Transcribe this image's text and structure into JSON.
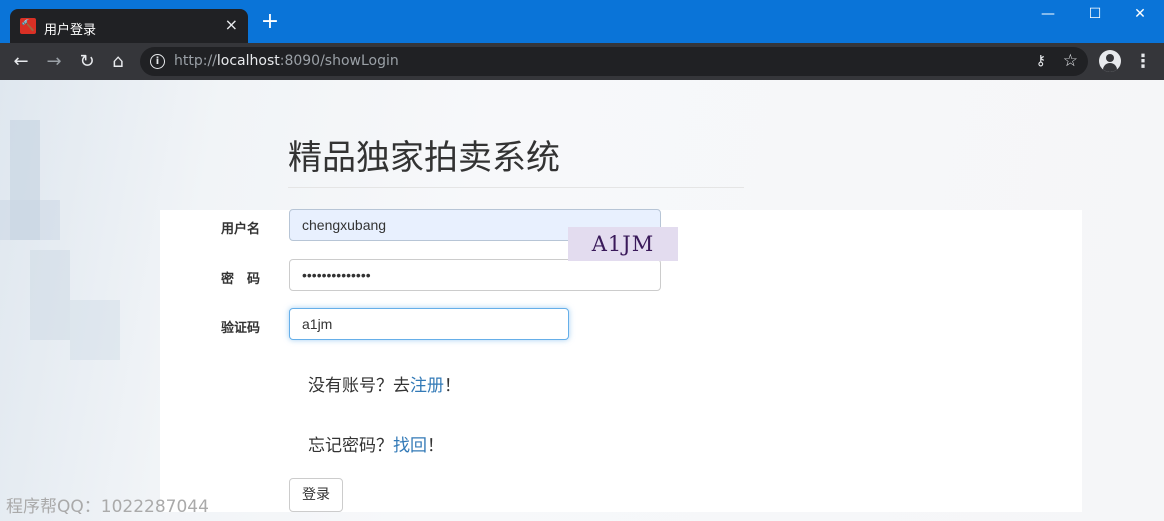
{
  "browser": {
    "tab": {
      "title": "用户登录",
      "favicon": "gavel-icon",
      "close": "×"
    },
    "new_tab": "+",
    "window_controls": {
      "minimize": "—",
      "maximize": "☐",
      "close": "✕"
    },
    "url": {
      "scheme": "http://",
      "host": "localhost",
      "rest": ":8090/showLogin"
    }
  },
  "page": {
    "title": "精品独家拍卖系统",
    "form": {
      "username": {
        "label": "用户名",
        "value": "chengxubang"
      },
      "password": {
        "label": "密　码",
        "value": "••••••••••••••"
      },
      "captcha": {
        "label": "验证码",
        "value": "a1jm",
        "image_text": "A1JM"
      }
    },
    "register_hint": {
      "before": "没有账号？去",
      "link": "注册",
      "after": "！"
    },
    "forgot_hint": {
      "before": "忘记密码？",
      "link": "找回",
      "after": "！"
    },
    "submit_label": "登录",
    "watermark": "程序帮QQ：1022287044"
  }
}
